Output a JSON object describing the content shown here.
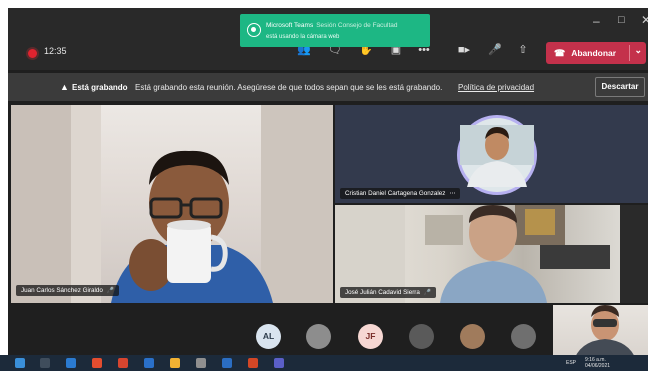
{
  "toast": {
    "app": "Microsoft Teams",
    "app_sub": "Sesión Consejo de Facultad",
    "message": "está usando la cámara web"
  },
  "call": {
    "timer": "12:35",
    "leave_label": "Abandonar"
  },
  "toolbar_icons": [
    "people-icon",
    "chat-icon",
    "raise-hand-icon",
    "share-tray-icon",
    "more-icon",
    "camera-icon",
    "mic-icon",
    "share-icon"
  ],
  "banner": {
    "title": "Está grabando",
    "text": "Está grabando esta reunión. Asegúrese de que todos sepan que se les está grabando.",
    "link": "Política de privacidad",
    "dismiss": "Descartar"
  },
  "participants": {
    "main": {
      "name": "Juan Carlos Sánchez Giraldo"
    },
    "cristian": {
      "name": "Cristian Daniel Cartagena Gonzalez"
    },
    "jose": {
      "name": "José Julián Cadavid Sierra"
    }
  },
  "strip": {
    "avatars": [
      {
        "initials": "AL",
        "color": "#d9e4ef",
        "text_color": "#2b3a4a"
      },
      {
        "initials": "",
        "color": "#8d8d8d",
        "text_color": "#ffffff"
      },
      {
        "initials": "JF",
        "color": "#f6d7d3",
        "text_color": "#7a2e2a"
      },
      {
        "initials": "",
        "color": "#5a5a5a",
        "text_color": "#ffffff"
      },
      {
        "initials": "",
        "color": "#a07b5c",
        "text_color": "#ffffff"
      },
      {
        "initials": "",
        "color": "#6f6f6f",
        "text_color": "#ffffff"
      }
    ]
  },
  "taskbar": {
    "lang": "ESP",
    "time": "9:16 a.m.",
    "date": "04/06/2021"
  },
  "colors": {
    "leave_red": "#c4314b",
    "toast_green": "#1db784",
    "recording_red": "#e0232f"
  }
}
